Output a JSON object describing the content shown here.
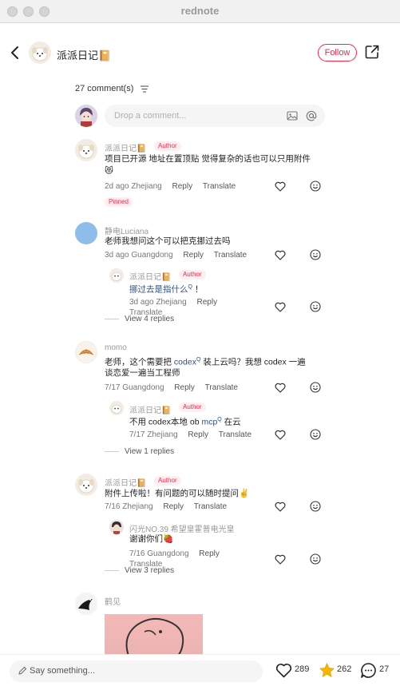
{
  "window": {
    "title": "rednote"
  },
  "header": {
    "author_name": "派派日记📔",
    "follow_label": "Follow"
  },
  "comments_count": "27 comment(s)",
  "comment_box": {
    "placeholder": "Drop a comment..."
  },
  "comments": [
    {
      "user": "派派日记📔",
      "author_tag": "Author",
      "text": "项目已开源 地址在置顶贴 觉得复杂的话也可以只用附件",
      "text2": "😻",
      "date_loc": "2d ago Zhejiang",
      "reply": "Reply",
      "translate": "Translate",
      "pinned": "Pinned"
    },
    {
      "user": "静电Luciana",
      "text": "老师我想问这个可以把克挪过去吗",
      "date_loc": "3d ago Guangdong",
      "reply": "Reply",
      "translate": "Translate",
      "reply_item": {
        "user": "派派日记📔",
        "author_tag": "Author",
        "text": "挪过去是指什么",
        "text_suffix": "！",
        "date_loc": "3d ago Zhejiang",
        "reply": "Reply",
        "translate": "Translate"
      },
      "view_more": "View 4 replies"
    },
    {
      "user": "momo",
      "text_a": "老师，这个需要把 ",
      "text_link": "codex",
      "text_b": " 装上云吗？我想 codex 一遍",
      "text2": "谈恋爱一遍当工程师",
      "date_loc": "7/17 Guangdong",
      "reply": "Reply",
      "translate": "Translate",
      "reply_item": {
        "user": "派派日记📔",
        "author_tag": "Author",
        "text_a": "不用 codex本地 ob  ",
        "text_link": "mcp",
        "text_b": " 在云",
        "date_loc": "7/17 Zhejiang",
        "reply": "Reply",
        "translate": "Translate"
      },
      "view_more": "View 1 replies"
    },
    {
      "user": "派派日记📔",
      "author_tag": "Author",
      "text": "附件上传啦！有问题的可以随时提问✌️",
      "date_loc": "7/16 Zhejiang",
      "reply": "Reply",
      "translate": "Translate",
      "reply_item": {
        "user": "闪光NO.39 希望皇霍普电光皇",
        "text": "谢谢你们🍓",
        "date_loc": "7/16 Guangdong",
        "reply": "Reply",
        "translate": "Translate"
      },
      "view_more": "View 3 replies"
    },
    {
      "user": "鹤见"
    }
  ],
  "bottom_bar": {
    "input_placeholder": "Say something...",
    "likes": "289",
    "stars": "262",
    "comments": "27"
  },
  "colors": {
    "accent": "#ff2442",
    "star": "#f7b500",
    "link": "#2a4f8a"
  }
}
